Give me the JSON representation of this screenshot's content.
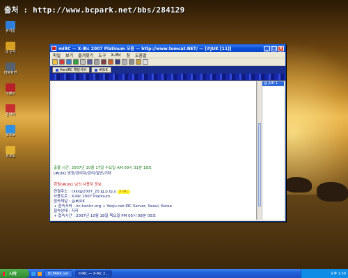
{
  "watermark": "출처 : http://www.bcpark.net/bbs/284129",
  "desktop_icons": [
    {
      "label": "휴지통",
      "color": "#2e7fdc"
    },
    {
      "label": "내 문서",
      "color": "#d8a020"
    },
    {
      "label": "바탕화면",
      "color": "#556070"
    },
    {
      "label": "이벤트",
      "color": "#b8202a"
    },
    {
      "label": "연락처",
      "color": "#c83030"
    },
    {
      "label": "X-IRc",
      "color": "#2f8fe0"
    },
    {
      "label": "X-IRc",
      "color": "#e0b030"
    }
  ],
  "window": {
    "title": "mIRC — X-IRc 2007 Platinum 모음 — http://www.tomcat.NET/ — [#JUK [11]]",
    "menu": [
      "파일",
      "보기",
      "즐겨찾기",
      "도구",
      "X-IRc",
      "창",
      "도움말"
    ],
    "tabs": [
      {
        "label": "HanIRC 채팅서버"
      },
      {
        "label": "#JUK"
      }
    ],
    "userlist_header": "@ JUK 1"
  },
  "chat_lines": [
    {
      "text": "출몰 시간: 2007년 10월 17일 수요일 AM 09시 31분 18초",
      "color": "green"
    },
    {
      "text": "[#JUK] 방장/관리자/관리/일반/기타",
      "color": "navy"
    },
    {
      "text": "회원(#JUK) 님의 사용자 정보",
      "color": "red"
    },
    {
      "text": "연결주소 : ckki@2007_20.jg.p.tjj.u",
      "color": "navy",
      "highlight": "X-IRc"
    },
    {
      "text": "사용프로 : X-IRc 2007 Platinum",
      "color": "navy"
    },
    {
      "text": "접속채널 : @#JUK",
      "color": "navy"
    },
    {
      "text": "+ 접속서버 : irc.hanirc.org + Yeoju.net IRC Server, Seoul, Korea",
      "color": "navy"
    },
    {
      "text": "접속상태 : 자리",
      "color": "navy"
    },
    {
      "text": "+ 접속시간 : 2007년 10월 18일 목요일 PM 05시 08분 05초",
      "color": "navy"
    }
  ],
  "taskbar": {
    "start_label": "시작",
    "tasks": [
      {
        "label": "BCPARK.net"
      },
      {
        "label": "mIRC — X-IRc 2..."
      }
    ],
    "clock": "오후 1:59"
  }
}
